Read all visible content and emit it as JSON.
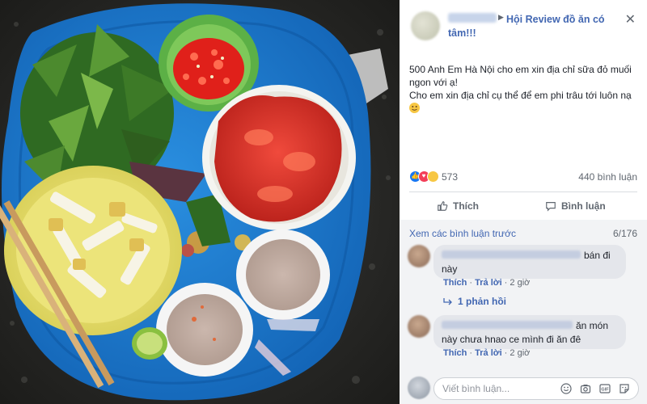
{
  "post": {
    "group_name": "Hội Review đồ ăn có tâm!!!",
    "text_lines": [
      "500 Anh Em Hà Nội cho em xin địa chỉ sữa đỏ muối ngon với ạ!",
      "Cho em xin địa chỉ cụ thể để em phi trâu tới luôn nạ"
    ],
    "reaction_count": "573",
    "comment_count": "440 bình luận",
    "like_label": "Thích",
    "comment_label": "Bình luận"
  },
  "comments_section": {
    "view_previous": "Xem các bình luận trước",
    "pagination": "6/176",
    "comments": [
      {
        "text_line1": "bán đi",
        "text_line2": "này",
        "like": "Thích",
        "reply": "Trả lời",
        "time": "2 giờ",
        "replies": "1 phản hồi"
      },
      {
        "text_line1": "ăn món",
        "text_line2": "này chưa hnao ce mình đi ăn đê",
        "like": "Thích",
        "reply": "Trả lời",
        "time": "2 giờ"
      }
    ],
    "composer_placeholder": "Viết bình luận..."
  },
  "icons": [
    "close-icon",
    "like-icon",
    "comment-icon",
    "reply-arrow-icon",
    "emoji-icon",
    "camera-icon",
    "gif-icon",
    "sticker-icon",
    "smile-emoji-icon"
  ],
  "colors": {
    "link": "#4267b2",
    "bubble": "#e4e6eb",
    "panel": "#ffffff",
    "comment_bg": "#f2f3f5"
  }
}
